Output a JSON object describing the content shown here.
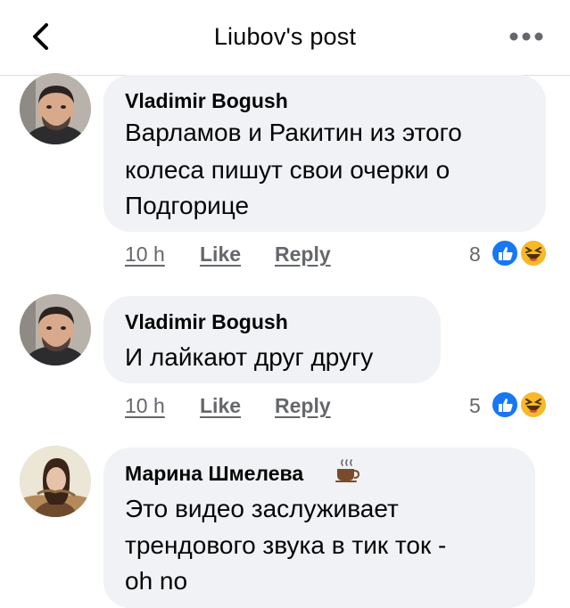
{
  "header": {
    "title": "Liubov's post"
  },
  "comments": [
    {
      "author": "Vladimir Bogush",
      "lines": [
        "Варламов и Ракитин из этого",
        "колеса пишут свои очерки о",
        "Подгорице"
      ],
      "time": "10 h",
      "like_label": "Like",
      "reply_label": "Reply",
      "reaction_count": "8",
      "reactions": [
        "like-icon",
        "haha-icon"
      ]
    },
    {
      "author": "Vladimir Bogush",
      "lines": [
        "И лайкают друг другу"
      ],
      "time": "10 h",
      "like_label": "Like",
      "reply_label": "Reply",
      "reaction_count": "5",
      "reactions": [
        "like-icon",
        "haha-icon"
      ]
    },
    {
      "author": "Марина Шмелева",
      "author_badge": "coffee-cup-icon",
      "lines": [
        "Это видео заслуживает",
        "трендового звука в тик ток -",
        "oh no"
      ]
    }
  ],
  "colors": {
    "bubble": "#f0f2f5",
    "meta_text": "#65676b",
    "like_blue": "#1877f2",
    "haha_yellow": "#f7b928"
  }
}
